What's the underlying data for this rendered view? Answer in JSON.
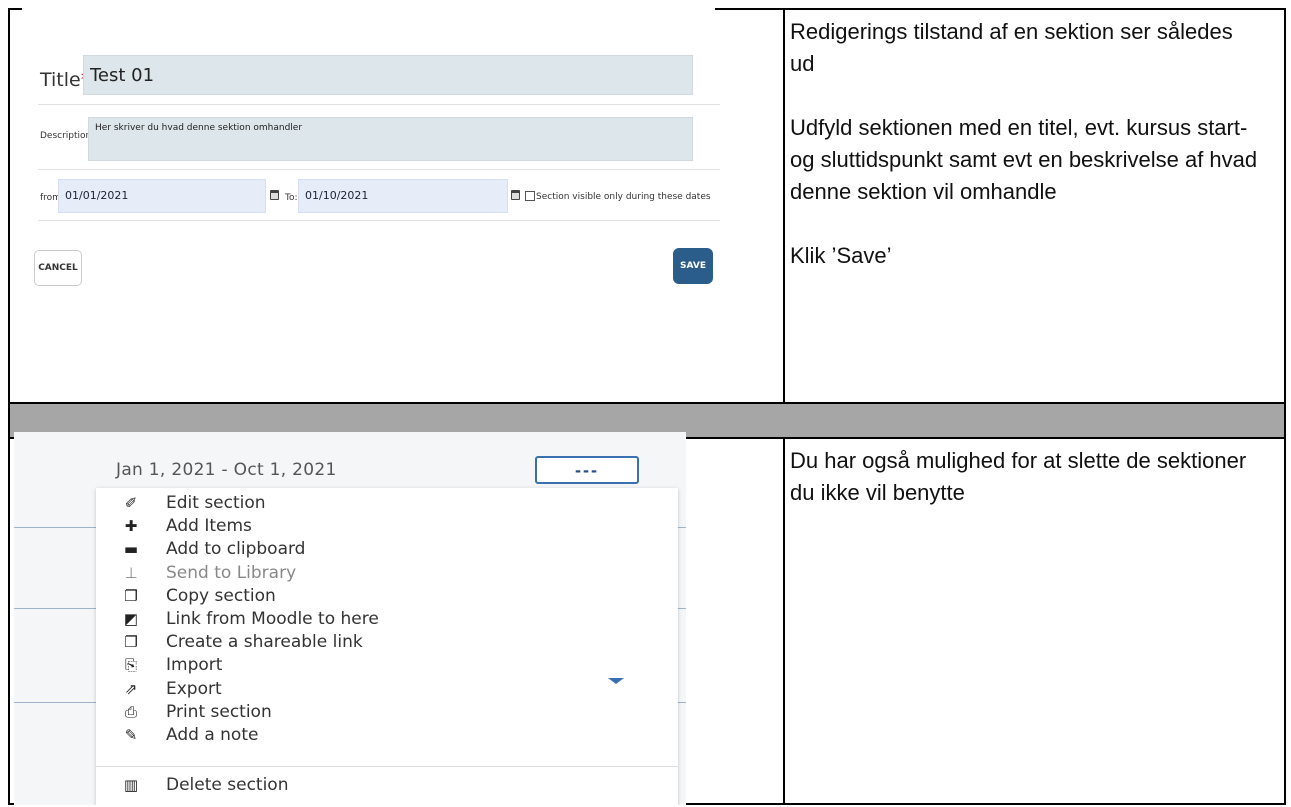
{
  "top_row": {
    "edit_form": {
      "title_label": "Title",
      "required_mark": "*",
      "title_colon": ":",
      "title_value": "Test 01",
      "description_label": "Description:",
      "description_value": "Her skriver du hvad denne sektion omhandler",
      "from_label": "from:",
      "from_value": "01/01/2021",
      "to_label": "To:",
      "to_value": "01/10/2021",
      "visible_label": "Section visible only during these dates",
      "cancel_label": "CANCEL",
      "save_label": "SAVE"
    },
    "instructions": [
      "Redigerings tilstand af en sektion ser således ud",
      "Udfyld sektionen med en titel, evt. kursus start- og sluttidspunkt samt evt en beskrivelse af hvad denne sektion vil omhandle",
      "Klik ’Save’"
    ]
  },
  "bottom_row": {
    "date_range": "Jan 1, 2021 - Oct 1, 2021",
    "menu_button": "---",
    "menu_items": [
      {
        "label": "Edit section",
        "icon": "pencil-icon",
        "glyph": "✐"
      },
      {
        "label": "Add Items",
        "icon": "plus-icon",
        "glyph": "✚"
      },
      {
        "label": "Add to clipboard",
        "icon": "clipboard-icon",
        "glyph": "▬"
      },
      {
        "label": "Send to Library",
        "icon": "pin-icon",
        "glyph": "⊥"
      },
      {
        "label": "Copy section",
        "icon": "copy-icon",
        "glyph": "❐"
      },
      {
        "label": "Link from Moodle to here",
        "icon": "link-icon",
        "glyph": "◩"
      },
      {
        "label": "Create a shareable link",
        "icon": "share-icon",
        "glyph": "❐"
      },
      {
        "label": "Import",
        "icon": "import-icon",
        "glyph": "⎘"
      },
      {
        "label": "Export",
        "icon": "export-icon",
        "glyph": "⇗"
      },
      {
        "label": "Print section",
        "icon": "print-icon",
        "glyph": "⎙"
      },
      {
        "label": "Add a note",
        "icon": "note-icon",
        "glyph": "✎"
      }
    ],
    "delete_item": {
      "label": "Delete section",
      "icon": "trash-icon",
      "glyph": "▥"
    },
    "instruction": "Du har også mulighed for at slette de sektioner du ikke vil benytte"
  },
  "colors": {
    "accent": "#2a5d8a",
    "field_bg": "#dde6ea",
    "separator_row": "#a6a6a6"
  }
}
